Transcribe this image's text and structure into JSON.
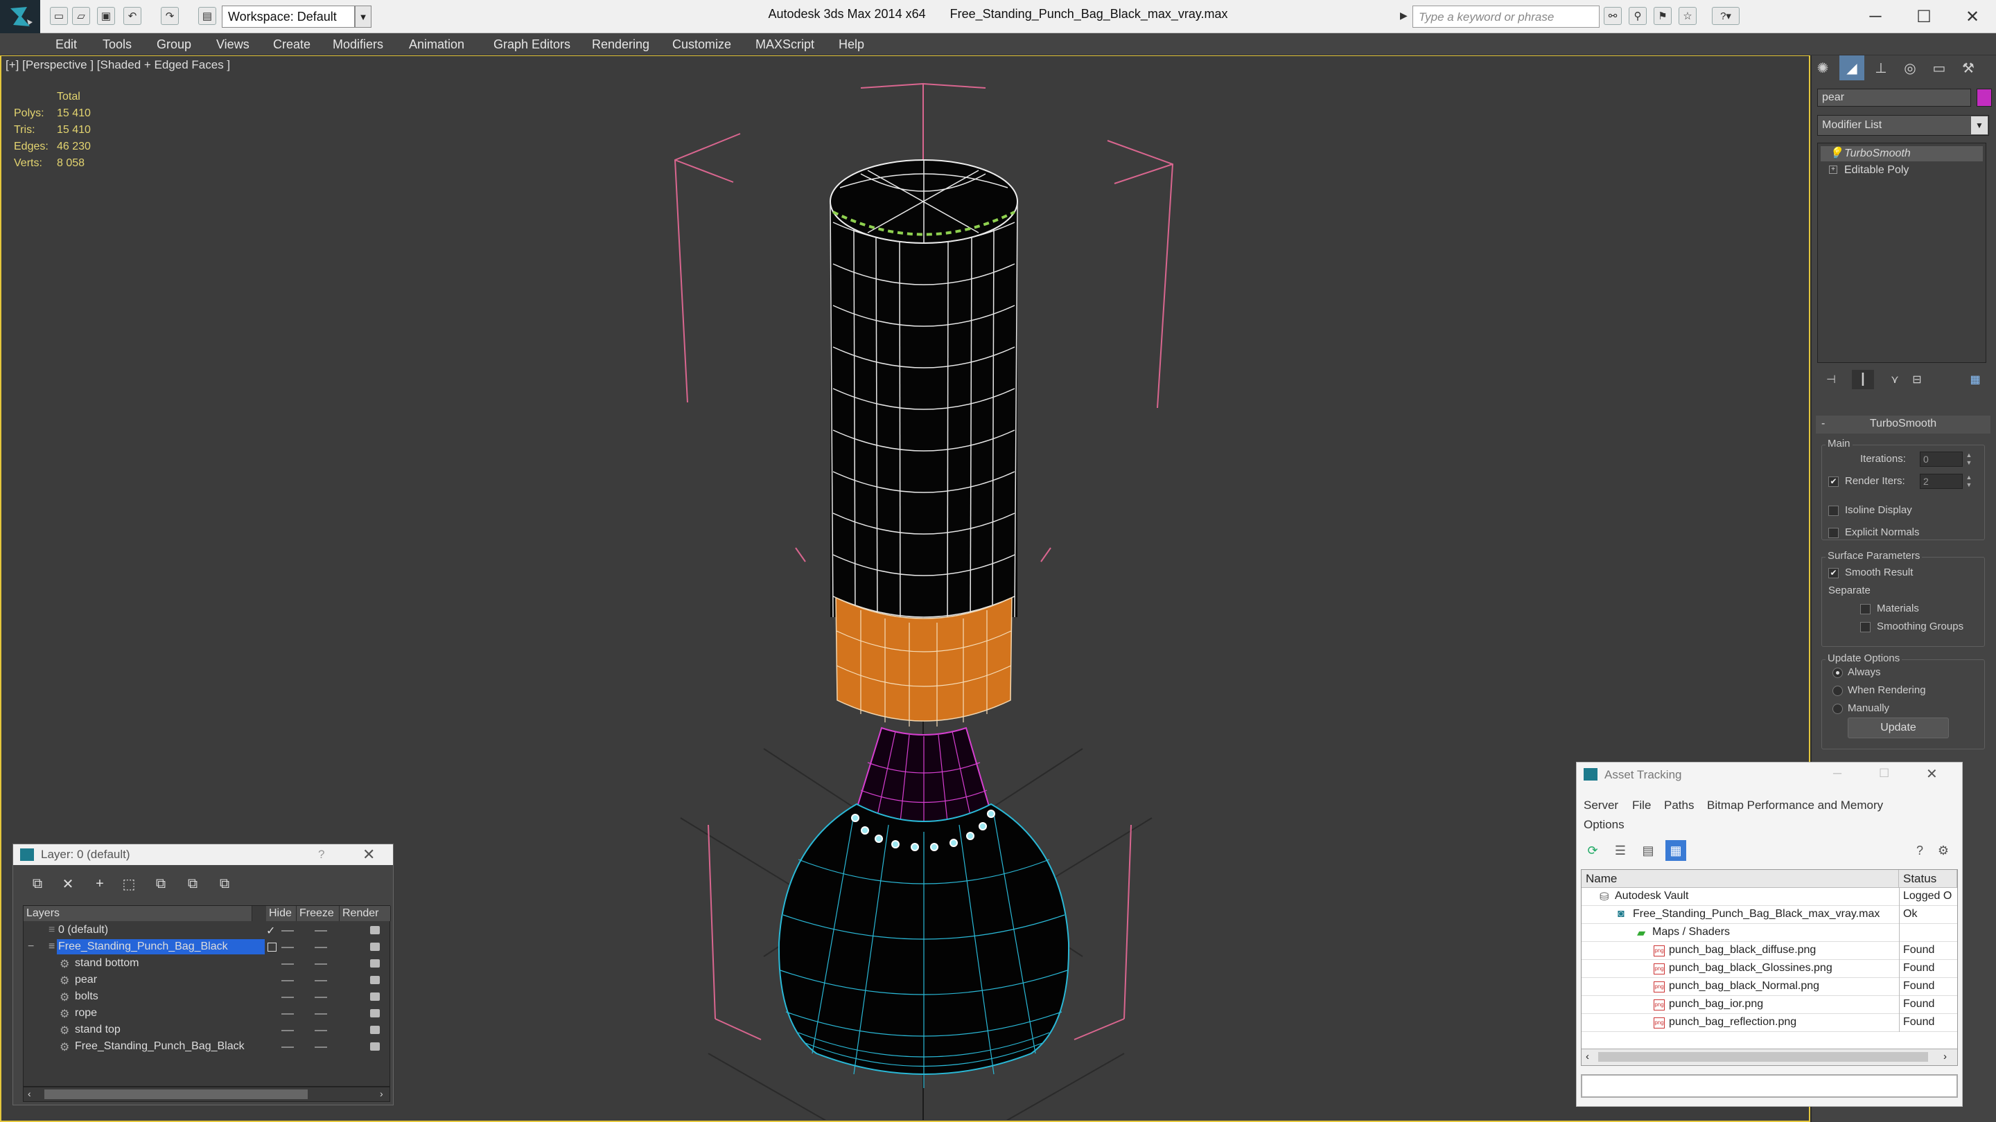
{
  "titlebar": {
    "app_title": "Autodesk 3ds Max  2014 x64",
    "file_title": "Free_Standing_Punch_Bag_Black_max_vray.max",
    "workspace": "Workspace: Default",
    "search_placeholder": "Type a keyword or phrase"
  },
  "menu": [
    "Edit",
    "Tools",
    "Group",
    "Views",
    "Create",
    "Modifiers",
    "Animation",
    "Graph Editors",
    "Rendering",
    "Customize",
    "MAXScript",
    "Help"
  ],
  "viewport": {
    "label": "[+] [Perspective ] [Shaded + Edged Faces ]",
    "stats": {
      "header": "Total",
      "rows": [
        {
          "label": "Polys:",
          "value": "15 410"
        },
        {
          "label": "Tris:",
          "value": "15 410"
        },
        {
          "label": "Edges:",
          "value": "46 230"
        },
        {
          "label": "Verts:",
          "value": "8 058"
        }
      ]
    }
  },
  "command_panel": {
    "object_name": "pear",
    "object_color": "#c32dc0",
    "modifier_list": "Modifier List",
    "stack": [
      "TurboSmooth",
      "Editable Poly"
    ],
    "rollout": {
      "title": "TurboSmooth",
      "main_group": "Main",
      "iterations_label": "Iterations:",
      "iterations_value": "0",
      "render_iters_label": "Render Iters:",
      "render_iters_value": "2",
      "isoline_label": "Isoline Display",
      "explicit_normals_label": "Explicit Normals",
      "surface_group": "Surface Parameters",
      "smooth_result_label": "Smooth Result",
      "separate_label": "Separate",
      "materials_label": "Materials",
      "smoothing_groups_label": "Smoothing Groups",
      "update_group": "Update Options",
      "always_label": "Always",
      "when_rendering_label": "When Rendering",
      "manually_label": "Manually",
      "update_button": "Update"
    }
  },
  "layer_panel": {
    "title": "Layer: 0 (default)",
    "help": "?",
    "columns": [
      "Layers",
      "Hide",
      "Freeze",
      "Render"
    ],
    "rows": [
      {
        "name": "0 (default)",
        "indent": 0
      },
      {
        "name": "Free_Standing_Punch_Bag_Black",
        "indent": 0
      },
      {
        "name": "stand bottom",
        "indent": 1
      },
      {
        "name": "pear",
        "indent": 1
      },
      {
        "name": "bolts",
        "indent": 1
      },
      {
        "name": "rope",
        "indent": 1
      },
      {
        "name": "stand top",
        "indent": 1
      },
      {
        "name": "Free_Standing_Punch_Bag_Black",
        "indent": 1
      }
    ]
  },
  "asset_tracking": {
    "title": "Asset Tracking",
    "menu": [
      "Server",
      "File",
      "Paths",
      "Bitmap Performance and Memory",
      "Options"
    ],
    "columns": [
      "Name",
      "Status"
    ],
    "rows": [
      {
        "name": "Autodesk Vault",
        "status": "Logged O"
      },
      {
        "name": "Free_Standing_Punch_Bag_Black_max_vray.max",
        "status": "Ok"
      },
      {
        "name": "Maps / Shaders",
        "status": ""
      },
      {
        "name": "punch_bag_black_diffuse.png",
        "status": "Found"
      },
      {
        "name": "punch_bag_black_Glossines.png",
        "status": "Found"
      },
      {
        "name": "punch_bag_black_Normal.png",
        "status": "Found"
      },
      {
        "name": "punch_bag_ior.png",
        "status": "Found"
      },
      {
        "name": "punch_bag_reflection.png",
        "status": "Found"
      }
    ]
  }
}
